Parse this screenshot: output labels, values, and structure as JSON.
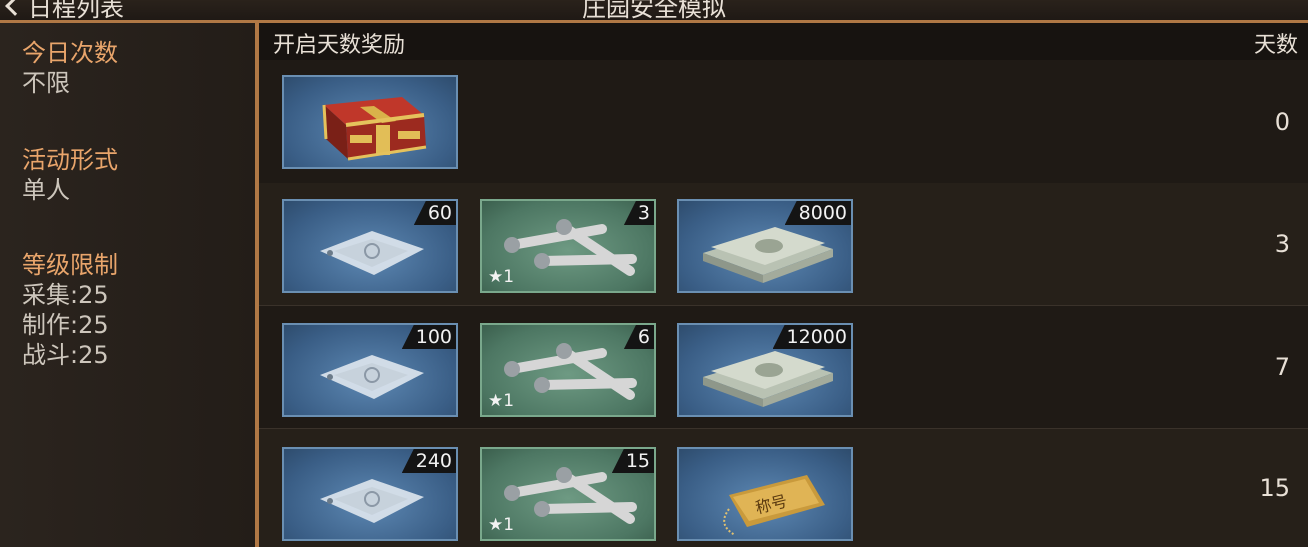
{
  "topbar": {
    "back_label": "日程列表",
    "title": "庄园安全模拟"
  },
  "sidebar": {
    "sections": [
      {
        "heading": "今日次数",
        "values": [
          "不限"
        ]
      },
      {
        "heading": "活动形式",
        "values": [
          "单人"
        ]
      },
      {
        "heading": "等级限制",
        "values": [
          "采集:25",
          "制作:25",
          "战斗:25"
        ]
      }
    ]
  },
  "table": {
    "header_left": "开启天数奖励",
    "header_right": "天数",
    "rows": [
      {
        "days": "0",
        "items": [
          {
            "type": "chest-icon",
            "qty": ""
          }
        ]
      },
      {
        "days": "3",
        "items": [
          {
            "type": "material-bag-icon",
            "qty": "60"
          },
          {
            "type": "pipe-parts-icon",
            "qty": "3",
            "star": "1"
          },
          {
            "type": "cash-stack-icon",
            "qty": "8000"
          }
        ]
      },
      {
        "days": "7",
        "items": [
          {
            "type": "material-bag-icon",
            "qty": "100"
          },
          {
            "type": "pipe-parts-icon",
            "qty": "6",
            "star": "1"
          },
          {
            "type": "cash-stack-icon",
            "qty": "12000"
          }
        ]
      },
      {
        "days": "15",
        "items": [
          {
            "type": "material-bag-icon",
            "qty": "240"
          },
          {
            "type": "pipe-parts-icon",
            "qty": "15",
            "star": "1"
          },
          {
            "type": "title-tag-icon",
            "qty": "",
            "tag_text": "称号"
          }
        ]
      }
    ]
  },
  "colors": {
    "accent": "#b07845",
    "heading": "#e9a56b",
    "item_blue": "#4a75a0",
    "item_green": "#5a8a72"
  }
}
